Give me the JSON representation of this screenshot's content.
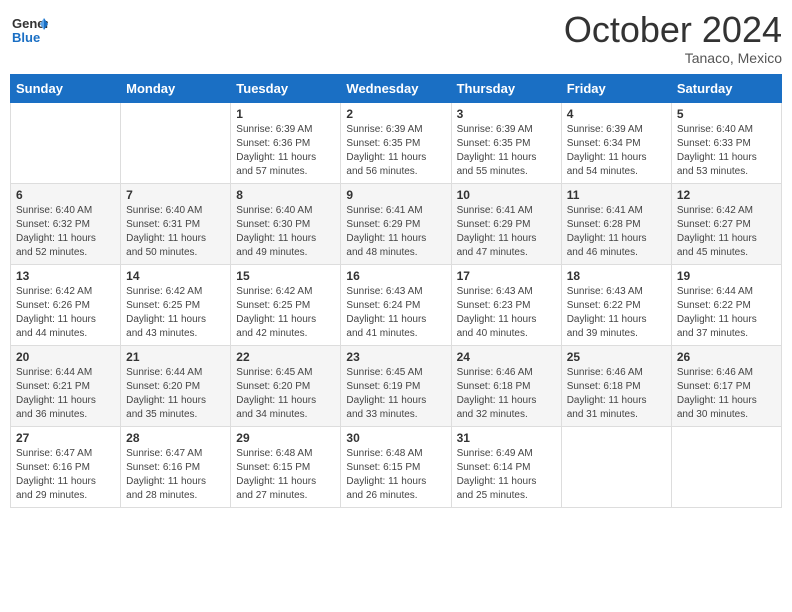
{
  "header": {
    "logo_general": "General",
    "logo_blue": "Blue",
    "month": "October 2024",
    "location": "Tanaco, Mexico"
  },
  "weekdays": [
    "Sunday",
    "Monday",
    "Tuesday",
    "Wednesday",
    "Thursday",
    "Friday",
    "Saturday"
  ],
  "weeks": [
    [
      null,
      null,
      {
        "day": 1,
        "sunrise": "6:39 AM",
        "sunset": "6:36 PM",
        "daylight": "11 hours and 57 minutes."
      },
      {
        "day": 2,
        "sunrise": "6:39 AM",
        "sunset": "6:35 PM",
        "daylight": "11 hours and 56 minutes."
      },
      {
        "day": 3,
        "sunrise": "6:39 AM",
        "sunset": "6:35 PM",
        "daylight": "11 hours and 55 minutes."
      },
      {
        "day": 4,
        "sunrise": "6:39 AM",
        "sunset": "6:34 PM",
        "daylight": "11 hours and 54 minutes."
      },
      {
        "day": 5,
        "sunrise": "6:40 AM",
        "sunset": "6:33 PM",
        "daylight": "11 hours and 53 minutes."
      }
    ],
    [
      {
        "day": 6,
        "sunrise": "6:40 AM",
        "sunset": "6:32 PM",
        "daylight": "11 hours and 52 minutes."
      },
      {
        "day": 7,
        "sunrise": "6:40 AM",
        "sunset": "6:31 PM",
        "daylight": "11 hours and 50 minutes."
      },
      {
        "day": 8,
        "sunrise": "6:40 AM",
        "sunset": "6:30 PM",
        "daylight": "11 hours and 49 minutes."
      },
      {
        "day": 9,
        "sunrise": "6:41 AM",
        "sunset": "6:29 PM",
        "daylight": "11 hours and 48 minutes."
      },
      {
        "day": 10,
        "sunrise": "6:41 AM",
        "sunset": "6:29 PM",
        "daylight": "11 hours and 47 minutes."
      },
      {
        "day": 11,
        "sunrise": "6:41 AM",
        "sunset": "6:28 PM",
        "daylight": "11 hours and 46 minutes."
      },
      {
        "day": 12,
        "sunrise": "6:42 AM",
        "sunset": "6:27 PM",
        "daylight": "11 hours and 45 minutes."
      }
    ],
    [
      {
        "day": 13,
        "sunrise": "6:42 AM",
        "sunset": "6:26 PM",
        "daylight": "11 hours and 44 minutes."
      },
      {
        "day": 14,
        "sunrise": "6:42 AM",
        "sunset": "6:25 PM",
        "daylight": "11 hours and 43 minutes."
      },
      {
        "day": 15,
        "sunrise": "6:42 AM",
        "sunset": "6:25 PM",
        "daylight": "11 hours and 42 minutes."
      },
      {
        "day": 16,
        "sunrise": "6:43 AM",
        "sunset": "6:24 PM",
        "daylight": "11 hours and 41 minutes."
      },
      {
        "day": 17,
        "sunrise": "6:43 AM",
        "sunset": "6:23 PM",
        "daylight": "11 hours and 40 minutes."
      },
      {
        "day": 18,
        "sunrise": "6:43 AM",
        "sunset": "6:22 PM",
        "daylight": "11 hours and 39 minutes."
      },
      {
        "day": 19,
        "sunrise": "6:44 AM",
        "sunset": "6:22 PM",
        "daylight": "11 hours and 37 minutes."
      }
    ],
    [
      {
        "day": 20,
        "sunrise": "6:44 AM",
        "sunset": "6:21 PM",
        "daylight": "11 hours and 36 minutes."
      },
      {
        "day": 21,
        "sunrise": "6:44 AM",
        "sunset": "6:20 PM",
        "daylight": "11 hours and 35 minutes."
      },
      {
        "day": 22,
        "sunrise": "6:45 AM",
        "sunset": "6:20 PM",
        "daylight": "11 hours and 34 minutes."
      },
      {
        "day": 23,
        "sunrise": "6:45 AM",
        "sunset": "6:19 PM",
        "daylight": "11 hours and 33 minutes."
      },
      {
        "day": 24,
        "sunrise": "6:46 AM",
        "sunset": "6:18 PM",
        "daylight": "11 hours and 32 minutes."
      },
      {
        "day": 25,
        "sunrise": "6:46 AM",
        "sunset": "6:18 PM",
        "daylight": "11 hours and 31 minutes."
      },
      {
        "day": 26,
        "sunrise": "6:46 AM",
        "sunset": "6:17 PM",
        "daylight": "11 hours and 30 minutes."
      }
    ],
    [
      {
        "day": 27,
        "sunrise": "6:47 AM",
        "sunset": "6:16 PM",
        "daylight": "11 hours and 29 minutes."
      },
      {
        "day": 28,
        "sunrise": "6:47 AM",
        "sunset": "6:16 PM",
        "daylight": "11 hours and 28 minutes."
      },
      {
        "day": 29,
        "sunrise": "6:48 AM",
        "sunset": "6:15 PM",
        "daylight": "11 hours and 27 minutes."
      },
      {
        "day": 30,
        "sunrise": "6:48 AM",
        "sunset": "6:15 PM",
        "daylight": "11 hours and 26 minutes."
      },
      {
        "day": 31,
        "sunrise": "6:49 AM",
        "sunset": "6:14 PM",
        "daylight": "11 hours and 25 minutes."
      },
      null,
      null
    ]
  ]
}
